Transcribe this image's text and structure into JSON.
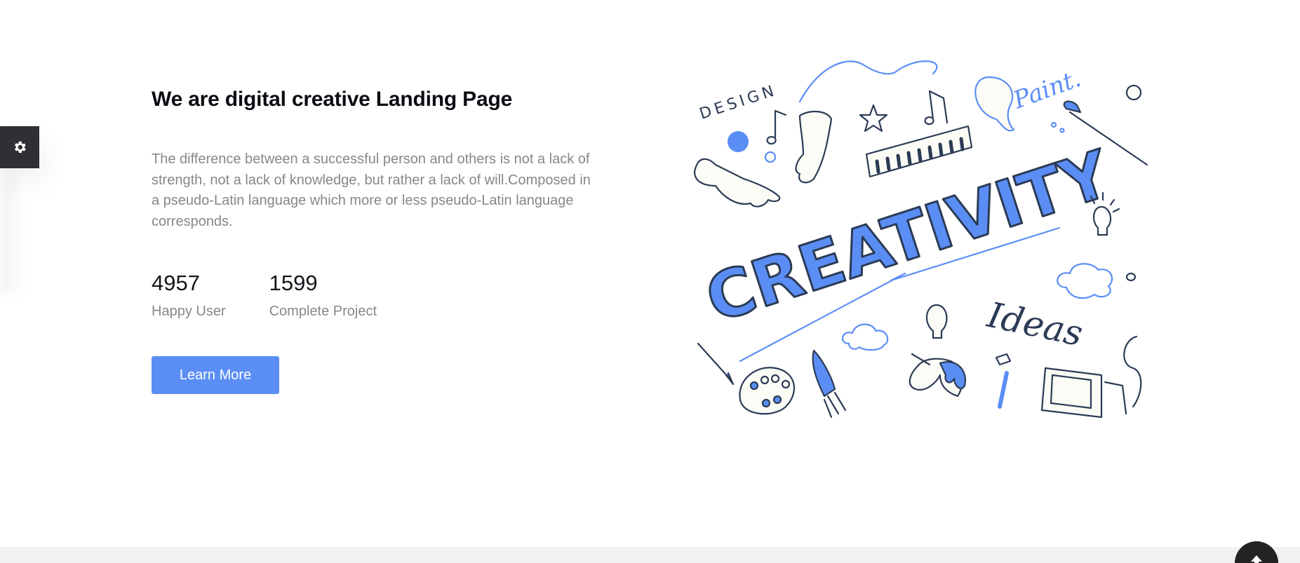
{
  "hero": {
    "title": "We are digital creative Landing Page",
    "description": "The difference between a successful person and others is not a lack of strength, not a lack of knowledge, but rather a lack of will.Composed in a pseudo-Latin language which more or less pseudo-Latin language corresponds.",
    "stats": [
      {
        "value": "4957",
        "label": "Happy User"
      },
      {
        "value": "1599",
        "label": "Complete Project"
      }
    ],
    "cta_label": "Learn More"
  },
  "illustration": {
    "words": [
      "DESIGN",
      "Paint.",
      "CREATIVITY",
      "Ideas"
    ]
  },
  "widgets": {
    "settings_icon": "gear-icon",
    "scroll_top_icon": "arrow-up-icon"
  },
  "colors": {
    "accent": "#5b8ef5",
    "outline": "#2b3b55",
    "panel": "#2f3033"
  }
}
